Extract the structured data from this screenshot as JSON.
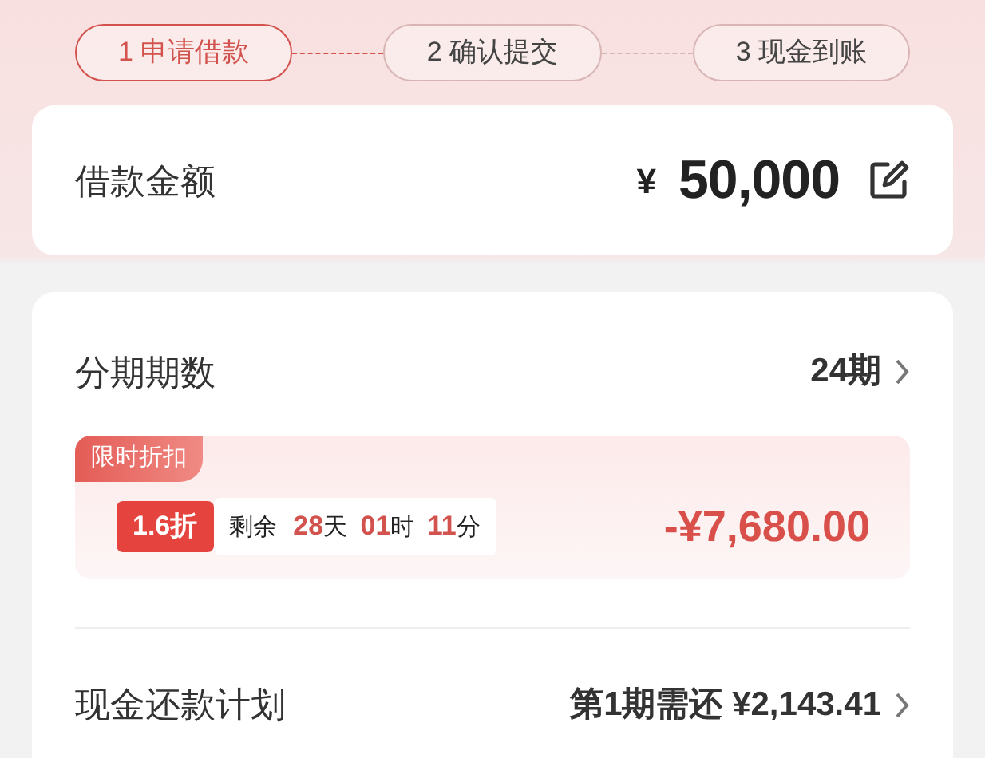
{
  "steps": [
    {
      "label": "1 申请借款",
      "selected": true
    },
    {
      "label": "2 确认提交",
      "selected": false
    },
    {
      "label": "3 现金到账",
      "selected": false
    }
  ],
  "loan_amount": {
    "label": "借款金额",
    "currency": "¥",
    "value": "50,000"
  },
  "installments": {
    "label": "分期期数",
    "value": "24期"
  },
  "discount": {
    "tag": "限时折扣",
    "rate": "1.6折",
    "countdown_label": "剩余",
    "countdown": [
      {
        "value": "28",
        "unit": "天"
      },
      {
        "value": "01",
        "unit": "时"
      },
      {
        "value": "11",
        "unit": "分"
      }
    ],
    "amount": "-¥7,680.00"
  },
  "repayment_plan": {
    "label": "现金还款计划",
    "value": "第1期需还 ¥2,143.41"
  }
}
